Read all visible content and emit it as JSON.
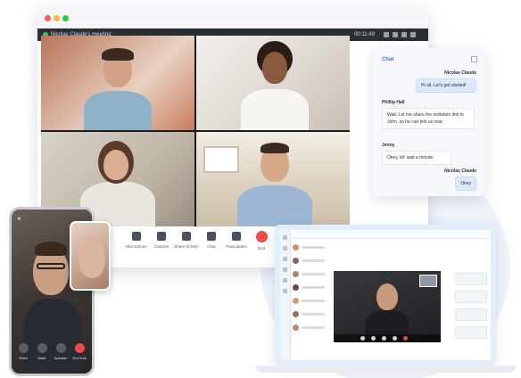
{
  "desktop": {
    "meeting_title": "Nicolas Claude's meeting",
    "meeting_time": "00:11:49",
    "controls": [
      {
        "label": "Microphone",
        "icon": "microphone-icon"
      },
      {
        "label": "Camera",
        "icon": "camera-icon"
      },
      {
        "label": "Share Screen",
        "icon": "share-screen-icon"
      },
      {
        "label": "Chat",
        "icon": "chat-icon"
      },
      {
        "label": "Participants",
        "icon": "participants-icon"
      },
      {
        "label": "End",
        "icon": "end-call-icon"
      }
    ]
  },
  "chat": {
    "title": "Chat",
    "messages": [
      {
        "sender": "Nicolas Claude",
        "text": "Hi all, Let's get started!",
        "mine": true
      },
      {
        "sender": "Phillip Hall",
        "text": "Wait, Let me share the invitation link to John, so he can join us now.",
        "mine": false
      },
      {
        "sender": "Jenny",
        "text": "Okey, let' wait a minute.",
        "mine": false
      },
      {
        "sender": "Nicolas Claude",
        "text": "Okey",
        "mine": true
      }
    ]
  },
  "phone": {
    "controls": [
      {
        "label": "Video",
        "icon": "video-icon"
      },
      {
        "label": "Mute",
        "icon": "mute-icon"
      },
      {
        "label": "Speaker",
        "icon": "speaker-icon"
      },
      {
        "label": "End Call",
        "icon": "end-call-icon"
      }
    ]
  },
  "colors": {
    "accent": "#3a6fd8",
    "end_call": "#f04a4a",
    "chat_bubble_mine": "#dde8fb"
  }
}
